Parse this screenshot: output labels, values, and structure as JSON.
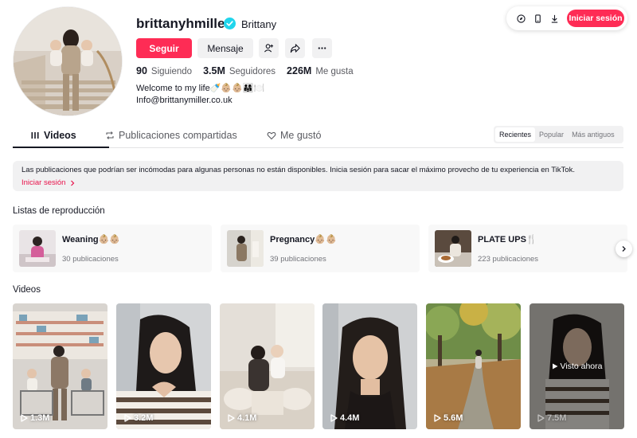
{
  "top_bar": {
    "login_label": "Iniciar sesión",
    "icons": [
      "compass-icon",
      "phone-icon",
      "download-icon"
    ]
  },
  "profile": {
    "username": "brittanyhmiller",
    "nickname": "Brittany",
    "verified": true,
    "follow_label": "Seguir",
    "message_label": "Mensaje",
    "stats": [
      {
        "value": "90",
        "label": "Siguiendo"
      },
      {
        "value": "3.5M",
        "label": "Seguidores"
      },
      {
        "value": "226M",
        "label": "Me gusta"
      }
    ],
    "bio_line1": "Welcome to my life🍼👶🏼👶🏼👨‍👩‍👧🍽️",
    "bio_line2": "Info@brittanymiller.co.uk"
  },
  "tabs": {
    "videos": "Videos",
    "reposts": "Publicaciones compartidas",
    "liked": "Me gustó"
  },
  "sort": {
    "options": [
      "Recientes",
      "Popular",
      "Más antiguos"
    ],
    "selected": "Recientes"
  },
  "notice": {
    "text": "Las publicaciones que podrían ser incómodas para algunas personas no están disponibles. Inicia sesión para sacar el máximo provecho de tu experiencia en TikTok.",
    "link": "Iniciar sesión"
  },
  "playlists_section": {
    "title": "Listas de reproducción",
    "items": [
      {
        "title": "Weaning👶🏼👶🏼",
        "count": "30 publicaciones"
      },
      {
        "title": "Pregnancy👶🏼👶🏼",
        "count": "39 publicaciones"
      },
      {
        "title": "PLATE UPS🍴",
        "count": "223 publicaciones"
      }
    ]
  },
  "videos_section": {
    "title": "Videos",
    "items": [
      {
        "views": "1.3M"
      },
      {
        "views": "3.2M"
      },
      {
        "views": "4.1M"
      },
      {
        "views": "4.4M"
      },
      {
        "views": "5.6M"
      },
      {
        "views": "7.5M",
        "watched_label": "Visto ahora"
      }
    ]
  },
  "colors": {
    "accent": "#fe2c55",
    "verified": "#20d5ec",
    "link": "#e8114a"
  }
}
